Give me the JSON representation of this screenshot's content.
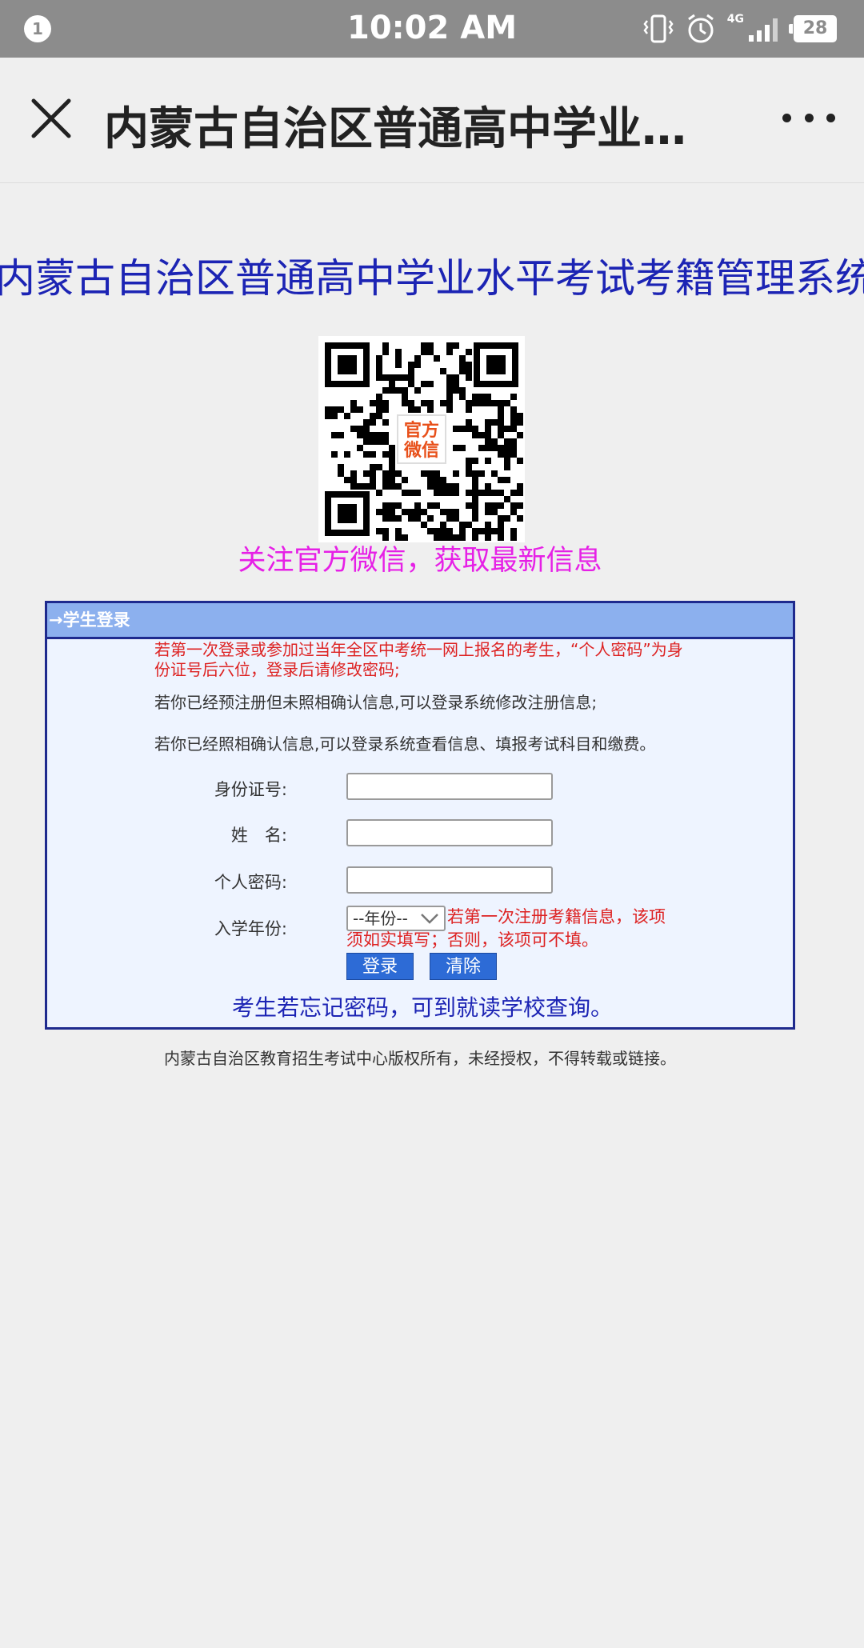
{
  "status_bar": {
    "notification_count": "1",
    "time": "10:02 AM",
    "network": "4G",
    "battery": "28",
    "icons": [
      "vibrate-icon",
      "alarm-icon",
      "signal-icon",
      "battery-icon"
    ]
  },
  "app_bar": {
    "title": "内蒙古自治区普通高中学业水平考试考籍管理系统",
    "close_icon": "close-icon",
    "more_icon": "more-icon"
  },
  "page": {
    "title": "内蒙古自治区普通高中学业水平考试考籍管理系统",
    "qr_label": "官方\n微信",
    "qr_label_line1": "官方",
    "qr_label_line2": "微信",
    "follow_text": "关注官方微信，获取最新信息"
  },
  "login": {
    "header": "→学生登录",
    "notice_red": "若第一次登录或参加过当年全区中考统一网上报名的考生，“个人密码”为身份证号后六位，登录后请修改密码;",
    "notice_1": "若你已经预注册但未照相确认信息,可以登录系统修改注册信息;",
    "notice_2": "若你已经照相确认信息,可以登录系统查看信息、填报考试科目和缴费。",
    "id_label": "身份证号:",
    "id_value": "",
    "name_label": "姓　名:",
    "name_value": "",
    "password_label": "个人密码:",
    "password_value": "",
    "year_label": "入学年份:",
    "year_selected": "--年份--",
    "year_note": "若第一次注册考籍信息，该项",
    "year_note_cont": "须如实填写；否则，该项可不填。",
    "login_button": "登录",
    "clear_button": "清除",
    "forgot_text": "考生若忘记密码，可到就读学校查询。"
  },
  "footer": "内蒙古自治区教育招生考试中心版权所有，未经授权，不得转载或链接。",
  "colors": {
    "status_bar": "#8c8c8c",
    "title_blue": "#1c24b4",
    "follow_magenta": "#e620e6",
    "panel_header": "#8cb0ee",
    "panel_border": "#1e2a8e",
    "notice_red": "#dd2222",
    "button_blue": "#2d6bd6"
  }
}
